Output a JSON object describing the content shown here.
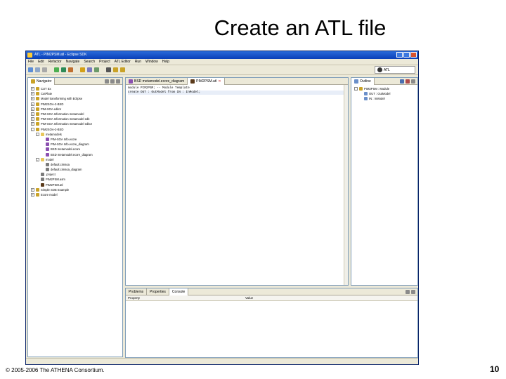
{
  "slide": {
    "title": "Create an ATL file",
    "copyright": "© 2005-2006 The ATHENA Consortium.",
    "page_number": "10"
  },
  "window": {
    "title": "ATL - PIM2PSM.atl - Eclipse SDK",
    "menu": [
      "File",
      "Edit",
      "Refactor",
      "Navigate",
      "Search",
      "Project",
      "ATL Editor",
      "Run",
      "Window",
      "Help"
    ],
    "perspective_label": "ATL"
  },
  "navigator": {
    "tab_label": "Navigator",
    "items": [
      {
        "label": "CUT Ex",
        "indent": 0,
        "expand": "+",
        "icon_color": "#c9a227"
      },
      {
        "label": "CutPlate",
        "indent": 0,
        "expand": "+",
        "icon_color": "#c9a227"
      },
      {
        "label": "Model transforming with Eclipse",
        "indent": 0,
        "expand": "+",
        "icon_color": "#c9a227"
      },
      {
        "label": "PIM2SOA-2-BSD",
        "indent": 0,
        "expand": "+",
        "icon_color": "#c9a227"
      },
      {
        "label": "PIM-SOA editor",
        "indent": 0,
        "expand": "+",
        "icon_color": "#c9a227"
      },
      {
        "label": "PIM-SOA Information metamodel",
        "indent": 0,
        "expand": "+",
        "icon_color": "#c9a227"
      },
      {
        "label": "PIM-SOA Information metamodel edit",
        "indent": 0,
        "expand": "+",
        "icon_color": "#c9a227"
      },
      {
        "label": "PIM-SOA Information metamodel editor",
        "indent": 0,
        "expand": "+",
        "icon_color": "#c9a227"
      },
      {
        "label": "PIM2SOA-2-BSD",
        "indent": 0,
        "expand": "-",
        "icon_color": "#c9a227"
      },
      {
        "label": "metamodels",
        "indent": 1,
        "expand": "-",
        "icon_color": "#e8c75a"
      },
      {
        "label": "PIM-SOA Info.ecore",
        "indent": 2,
        "expand": "",
        "icon_color": "#8a4fb0"
      },
      {
        "label": "PIM-SOA Info.ecore_diagram",
        "indent": 2,
        "expand": "",
        "icon_color": "#8a4fb0"
      },
      {
        "label": "BSD metamodel.ecore",
        "indent": 2,
        "expand": "",
        "icon_color": "#8a4fb0"
      },
      {
        "label": "BSD metamodel.ecore_diagram",
        "indent": 2,
        "expand": "",
        "icon_color": "#8a4fb0"
      },
      {
        "label": "model",
        "indent": 1,
        "expand": "-",
        "icon_color": "#e8c75a"
      },
      {
        "label": "default.cimsoa",
        "indent": 2,
        "expand": "",
        "icon_color": "#7a7a7a"
      },
      {
        "label": "default.cimsoa_diagram",
        "indent": 2,
        "expand": "",
        "icon_color": "#7a7a7a"
      },
      {
        "label": ".project",
        "indent": 1,
        "expand": "",
        "icon_color": "#7a7a7a"
      },
      {
        "label": "PIM2PSM.asm",
        "indent": 1,
        "expand": "",
        "icon_color": "#7a7a7a"
      },
      {
        "label": "PIM2PSM.atl",
        "indent": 1,
        "expand": "",
        "icon_color": "#5a3a1a"
      },
      {
        "label": "Simple SOE Example",
        "indent": 0,
        "expand": "+",
        "icon_color": "#c9a227"
      },
      {
        "label": "Ecore model",
        "indent": 0,
        "expand": "+",
        "icon_color": "#c9a227"
      }
    ]
  },
  "editor": {
    "tabs": [
      {
        "label": "BSD metamodel.ecore_diagram",
        "active": false
      },
      {
        "label": "PIM2PSM.atl",
        "active": true
      }
    ],
    "lines": [
      "module PIM2PSM;  -- Module Template",
      "create OUT : OutModel from IN : InModel;"
    ]
  },
  "outline": {
    "tab_label": "Outline",
    "items": [
      {
        "label": "PIM2PSM : Module",
        "indent": 0,
        "expand": "-"
      },
      {
        "label": "OUT : OutModel",
        "indent": 1,
        "expand": ""
      },
      {
        "label": "IN : InModel",
        "indent": 1,
        "expand": ""
      }
    ]
  },
  "bottom": {
    "tabs": [
      {
        "label": "Problems",
        "active": false
      },
      {
        "label": "Properties",
        "active": false
      },
      {
        "label": "Console",
        "active": true
      }
    ],
    "columns": [
      "Property",
      "Value"
    ]
  }
}
